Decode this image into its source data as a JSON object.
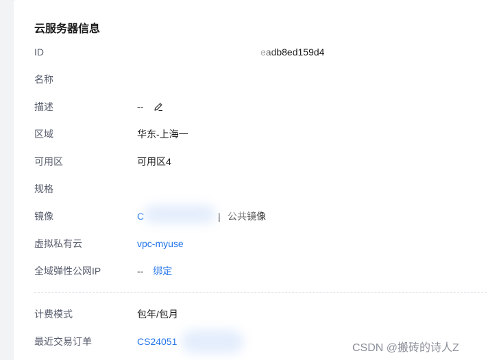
{
  "section_title": "云服务器信息",
  "rows": {
    "id": {
      "label": "ID",
      "value": "eadb8ed159d4"
    },
    "name": {
      "label": "名称",
      "value": ""
    },
    "desc": {
      "label": "描述",
      "value": "--"
    },
    "region": {
      "label": "区域",
      "value": "华东-上海一"
    },
    "az": {
      "label": "可用区",
      "value": "可用区4"
    },
    "spec": {
      "label": "规格",
      "value": ""
    },
    "image": {
      "label": "镜像",
      "value_prefix": "C",
      "separator": "|",
      "value_suffix": "公共镜像"
    },
    "vpc": {
      "label": "虚拟私有云",
      "value": "vpc-myuse"
    },
    "eip": {
      "label": "全域弹性公网IP",
      "value": "--",
      "action": "绑定"
    },
    "billing": {
      "label": "计费模式",
      "value": "包年/包月"
    },
    "order": {
      "label": "最近交易订单",
      "value": "CS24051"
    }
  },
  "watermark": "CSDN @搬砖的诗人Z",
  "icons": {
    "edit": "pencil-icon"
  },
  "colors": {
    "link": "#1f72e8",
    "label": "#575d6c",
    "text": "#191919"
  }
}
